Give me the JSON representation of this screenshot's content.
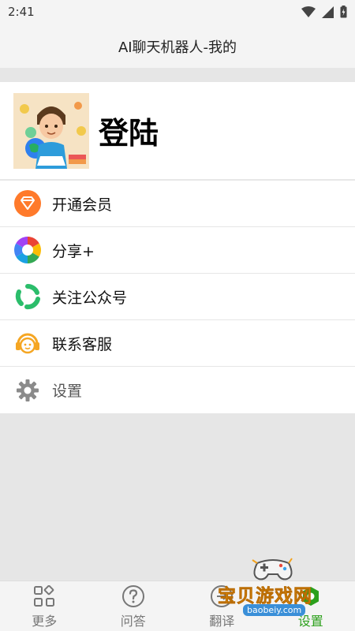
{
  "status_bar": {
    "time": "2:41"
  },
  "app_bar": {
    "title": "AI聊天机器人-我的"
  },
  "profile": {
    "login_label": "登陆"
  },
  "menu": {
    "items": [
      {
        "label": "开通会员",
        "icon": "vip-diamond-icon"
      },
      {
        "label": "分享+",
        "icon": "share-aperture-icon"
      },
      {
        "label": "关注公众号",
        "icon": "wechat-official-icon"
      },
      {
        "label": "联系客服",
        "icon": "customer-service-icon"
      },
      {
        "label": "设置",
        "icon": "gear-icon"
      }
    ]
  },
  "bottom_nav": {
    "items": [
      {
        "label": "更多",
        "icon": "grid-more-icon"
      },
      {
        "label": "问答",
        "icon": "question-icon"
      },
      {
        "label": "翻译",
        "icon": "translate-icon"
      },
      {
        "label": "设置",
        "icon": "settings-icon",
        "active": true
      }
    ]
  },
  "watermark": {
    "text": "宝贝游戏网",
    "url": "baobeiy.com"
  },
  "colors": {
    "accent": "#2ca01c",
    "vip": "#ff7a2b",
    "wechat": "#2bbd6b",
    "service": "#f5a623"
  }
}
